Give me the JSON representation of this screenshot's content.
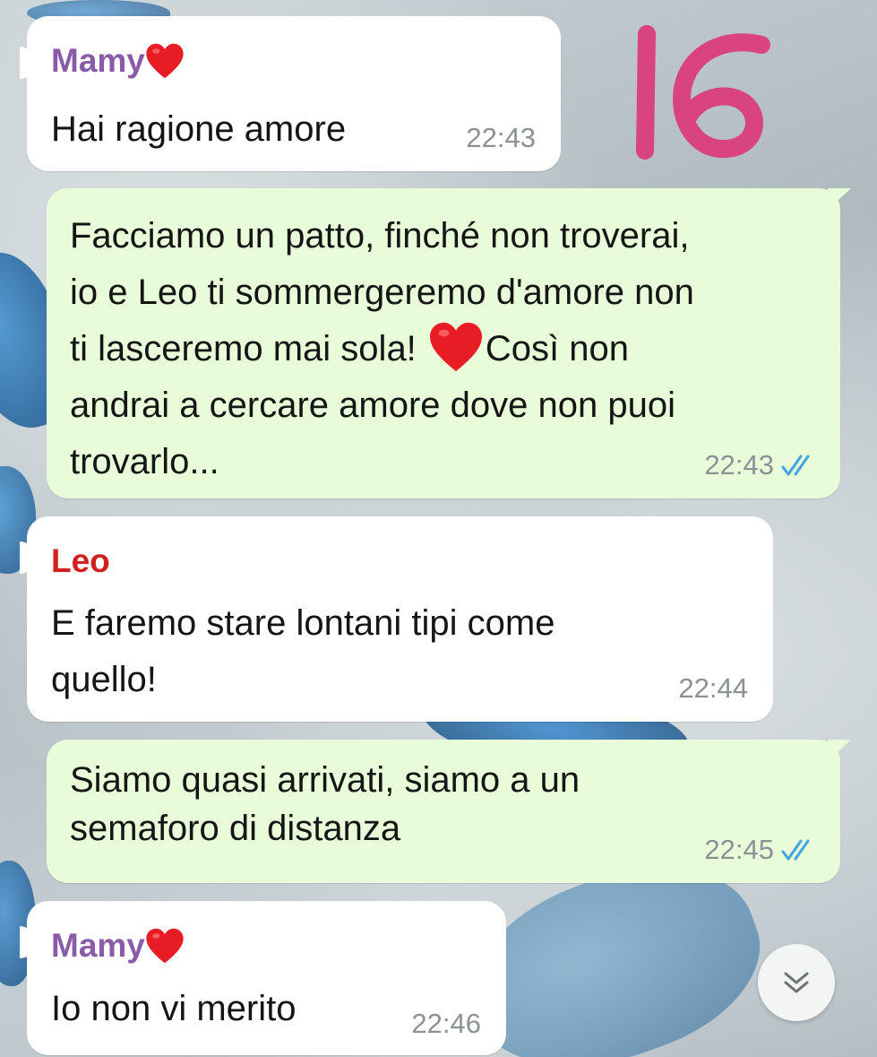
{
  "annotation_number": "16",
  "messages": [
    {
      "direction": "incoming",
      "sender": "Mamy",
      "sender_emoji": "heart",
      "text": "Hai ragione amore",
      "time": "22:43"
    },
    {
      "direction": "outgoing",
      "text_before_emoji": "Facciamo un patto, finché non troverai,\nio e Leo ti sommergeremo d'amore non\nti lasceremo mai sola! ",
      "emoji": "heart",
      "text_after_emoji": "Così non\nandrai a cercare amore dove non puoi\ntrovarlo...",
      "time": "22:43",
      "status": "read"
    },
    {
      "direction": "incoming",
      "sender": "Leo",
      "text": "E faremo stare lontani tipi come\nquello!",
      "time": "22:44"
    },
    {
      "direction": "outgoing",
      "text": "Siamo quasi arrivati, siamo a un\nsemaforo di distanza",
      "time": "22:45",
      "status": "read"
    },
    {
      "direction": "incoming",
      "sender": "Mamy",
      "sender_emoji": "heart",
      "text": "Io non vi merito",
      "time": "22:46"
    }
  ],
  "scroll_button_icon": "chevron-double-down-icon",
  "colors": {
    "incoming_bubble": "#ffffff",
    "outgoing_bubble": "#e8fcd9",
    "sender_mamy": "#8a5ba8",
    "sender_leo": "#d0201f",
    "timestamp": "#8b9195",
    "read_ticks": "#3fa5e0",
    "annotation": "#d9437e"
  }
}
